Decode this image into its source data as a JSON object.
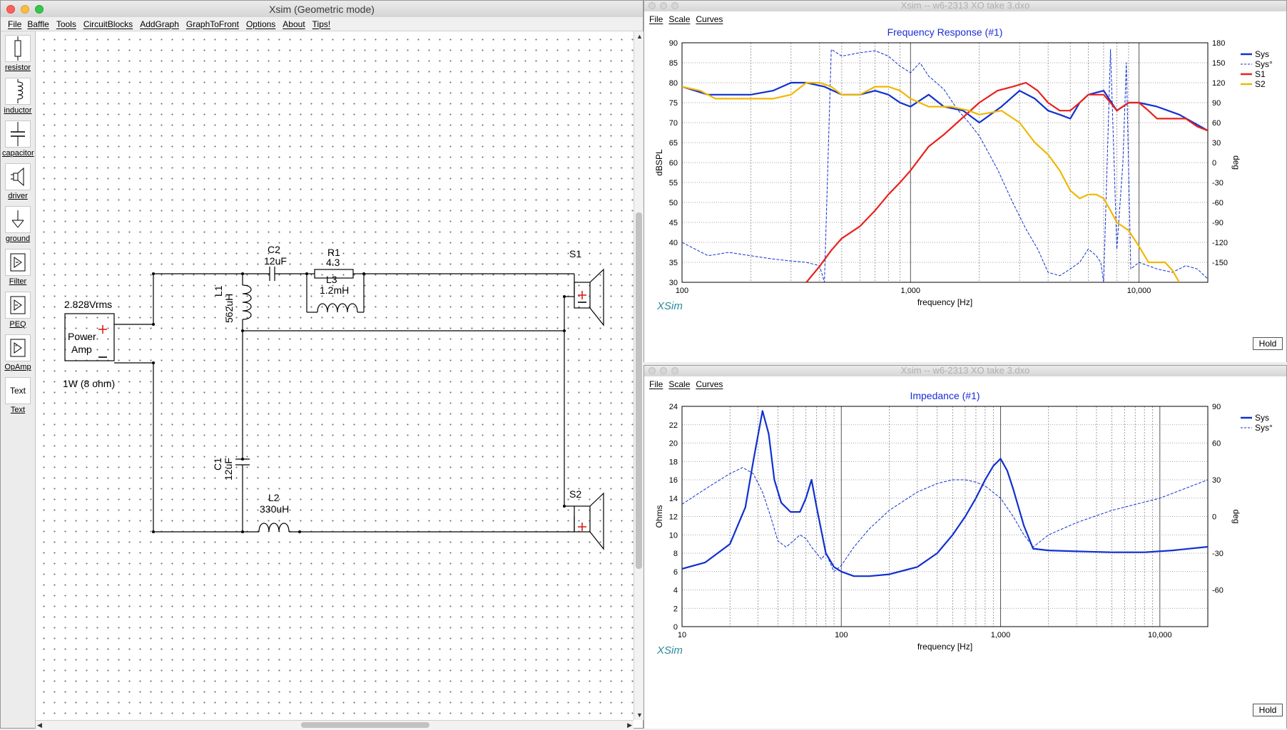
{
  "main_window": {
    "title": "Xsim (Geometric mode)",
    "menu": [
      "File",
      "Baffle",
      "Tools",
      "CircuitBlocks",
      "AddGraph",
      "GraphToFront",
      "Options",
      "About",
      "Tips!"
    ],
    "palette": [
      {
        "label": "resistor",
        "icon": "resistor-icon"
      },
      {
        "label": "inductor",
        "icon": "inductor-icon"
      },
      {
        "label": "capacitor",
        "icon": "capacitor-icon"
      },
      {
        "label": "driver",
        "icon": "speaker-driver-icon"
      },
      {
        "label": "ground",
        "icon": "ground-icon"
      },
      {
        "label": "Filter",
        "icon": "filter-icon"
      },
      {
        "label": "PEQ",
        "icon": "peq-icon"
      },
      {
        "label": "OpAmp",
        "icon": "opamp-icon"
      },
      {
        "label": "Text",
        "icon": "text-icon",
        "icon_text": "Text"
      }
    ]
  },
  "circuit": {
    "amp": {
      "voltage": "2.828Vrms",
      "line1": "Power",
      "line2": "Amp",
      "plus": "+",
      "minus": "−",
      "load": "1W (8 ohm)"
    },
    "c2": {
      "name": "C2",
      "value": "12uF"
    },
    "r1": {
      "name": "R1",
      "value": "4.3"
    },
    "l3": {
      "name": "L3",
      "value": "1.2mH"
    },
    "l1": {
      "name": "L1",
      "value": "562uH"
    },
    "c1": {
      "name": "C1",
      "value": "12uF"
    },
    "l2": {
      "name": "L2",
      "value": "330uH"
    },
    "s1": {
      "name": "S1"
    },
    "s2": {
      "name": "S2"
    }
  },
  "graph_fr": {
    "window_title": "Xsim -- w6-2313 XO take 3.dxo",
    "menu": [
      "File",
      "Scale",
      "Curves"
    ],
    "title": "Frequency Response (#1)",
    "ylabel": "dBSPL",
    "y2label": "deg",
    "xlabel": "frequency [Hz]",
    "yticks": [
      "90",
      "85",
      "80",
      "75",
      "70",
      "65",
      "60",
      "55",
      "50",
      "45",
      "40",
      "35",
      "30"
    ],
    "y2ticks": [
      "180",
      "150",
      "120",
      "90",
      "60",
      "30",
      "0",
      "-30",
      "-60",
      "-90",
      "-120",
      "-150"
    ],
    "xticks": [
      "100",
      "1,000",
      "10,000"
    ],
    "legend": [
      {
        "name": "Sys",
        "color": "#1030d0",
        "dash": false
      },
      {
        "name": "Sys°",
        "color": "#1030d0",
        "dash": true
      },
      {
        "name": "S1",
        "color": "#e8221c",
        "dash": false
      },
      {
        "name": "S2",
        "color": "#f0b800",
        "dash": false
      }
    ],
    "brand": "XSim",
    "hold": "Hold"
  },
  "graph_imp": {
    "window_title": "Xsim -- w6-2313 XO take 3.dxo",
    "menu": [
      "File",
      "Scale",
      "Curves"
    ],
    "title": "Impedance (#1)",
    "ylabel": "Ohms",
    "y2label": "deg",
    "xlabel": "frequency [Hz]",
    "yticks": [
      "24",
      "22",
      "20",
      "18",
      "16",
      "14",
      "12",
      "10",
      "8",
      "6",
      "4",
      "2",
      "0"
    ],
    "y2ticks": [
      "90",
      "60",
      "30",
      "0",
      "-30",
      "-60"
    ],
    "xticks": [
      "10",
      "100",
      "1,000",
      "10,000"
    ],
    "legend": [
      {
        "name": "Sys",
        "color": "#1030d0",
        "dash": false
      },
      {
        "name": "Sys°",
        "color": "#1030d0",
        "dash": true
      }
    ],
    "brand": "XSim",
    "hold": "Hold"
  },
  "chart_data": [
    {
      "type": "line",
      "title": "Frequency Response (#1)",
      "xlabel": "frequency [Hz]",
      "ylabel": "dBSPL",
      "y2label": "deg",
      "xscale": "log",
      "xlim": [
        100,
        20000
      ],
      "ylim": [
        30,
        90
      ],
      "y2lim": [
        -180,
        180
      ],
      "grid": true,
      "legend_position": "right",
      "series": [
        {
          "name": "Sys",
          "axis": "y",
          "x": [
            100,
            130,
            160,
            200,
            250,
            300,
            350,
            420,
            500,
            600,
            700,
            800,
            900,
            1000,
            1200,
            1400,
            1700,
            2000,
            2500,
            3000,
            3500,
            4000,
            4500,
            5000,
            5500,
            6000,
            7000,
            8000,
            9000,
            10000,
            12000,
            15000,
            20000
          ],
          "y": [
            79,
            77,
            77,
            77,
            78,
            80,
            80,
            79,
            77,
            77,
            78,
            77,
            75,
            74,
            77,
            74,
            73,
            70,
            74,
            78,
            76,
            73,
            72,
            71,
            75,
            77,
            78,
            73,
            75,
            75,
            74,
            72,
            68
          ]
        },
        {
          "name": "Sys°",
          "axis": "y2",
          "x": [
            100,
            130,
            160,
            200,
            250,
            300,
            350,
            400,
            420,
            450,
            500,
            600,
            700,
            800,
            900,
            1000,
            1100,
            1200,
            1400,
            1600,
            1800,
            2000,
            2400,
            2800,
            3200,
            3600,
            4000,
            4500,
            5000,
            5500,
            6000,
            6500,
            6800,
            7000,
            7500,
            8000,
            8500,
            8800,
            9200,
            10000,
            12000,
            14000,
            16000,
            18000,
            20000
          ],
          "y": [
            -120,
            -140,
            -135,
            -140,
            -145,
            -148,
            -150,
            -155,
            -180,
            170,
            160,
            165,
            168,
            160,
            145,
            135,
            150,
            130,
            110,
            80,
            60,
            40,
            -10,
            -60,
            -100,
            -130,
            -165,
            -170,
            -160,
            -150,
            -130,
            -140,
            -150,
            -180,
            170,
            -130,
            0,
            150,
            -160,
            -150,
            -160,
            -165,
            -155,
            -160,
            -175
          ]
        },
        {
          "name": "S1",
          "axis": "y",
          "x": [
            350,
            400,
            450,
            500,
            600,
            700,
            800,
            900,
            1000,
            1200,
            1400,
            1600,
            2000,
            2400,
            2800,
            3200,
            3600,
            4000,
            4500,
            5000,
            5500,
            6000,
            6500,
            7000,
            7500,
            8000,
            9000,
            10000,
            11000,
            12000,
            14000,
            16000,
            18000,
            20000
          ],
          "y": [
            30,
            34,
            38,
            41,
            44,
            48,
            52,
            55,
            58,
            64,
            67,
            70,
            75,
            78,
            79,
            80,
            78,
            75,
            73,
            73,
            75,
            77,
            77,
            77,
            75,
            73,
            75,
            75,
            73,
            71,
            71,
            71,
            69,
            68
          ]
        },
        {
          "name": "S2",
          "axis": "y",
          "x": [
            100,
            120,
            140,
            160,
            200,
            250,
            300,
            350,
            400,
            450,
            500,
            600,
            700,
            800,
            900,
            1000,
            1200,
            1500,
            1800,
            2000,
            2500,
            3000,
            3500,
            4000,
            4500,
            5000,
            5500,
            6000,
            6500,
            7000,
            7500,
            8000,
            9000,
            10000,
            11000,
            12000,
            13000,
            14000,
            15000
          ],
          "y": [
            79,
            78,
            76,
            76,
            76,
            76,
            77,
            80,
            80,
            79,
            77,
            77,
            79,
            79,
            78,
            76,
            74,
            74,
            73,
            72,
            73,
            70,
            65,
            62,
            58,
            53,
            51,
            52,
            52,
            51,
            48,
            45,
            43,
            39,
            35,
            35,
            35,
            33,
            30
          ]
        }
      ]
    },
    {
      "type": "line",
      "title": "Impedance (#1)",
      "xlabel": "frequency [Hz]",
      "ylabel": "Ohms",
      "y2label": "deg",
      "xscale": "log",
      "xlim": [
        10,
        20000
      ],
      "ylim": [
        0,
        24
      ],
      "y2lim": [
        -90,
        90
      ],
      "grid": true,
      "legend_position": "right",
      "series": [
        {
          "name": "Sys",
          "axis": "y",
          "x": [
            10,
            14,
            20,
            25,
            28,
            32,
            35,
            38,
            42,
            48,
            55,
            60,
            65,
            70,
            80,
            90,
            100,
            120,
            150,
            200,
            300,
            400,
            500,
            600,
            700,
            800,
            900,
            1000,
            1100,
            1200,
            1400,
            1600,
            2000,
            3000,
            5000,
            8000,
            12000,
            20000
          ],
          "y": [
            6.3,
            7,
            9,
            13,
            18,
            23.5,
            21,
            16,
            13.5,
            12.5,
            12.5,
            14,
            16,
            13,
            8,
            6.5,
            6,
            5.5,
            5.5,
            5.7,
            6.5,
            8,
            10,
            12,
            14,
            16,
            17.5,
            18.3,
            17,
            15,
            11,
            8.5,
            8.3,
            8.2,
            8.1,
            8.1,
            8.3,
            8.7
          ]
        },
        {
          "name": "Sys°",
          "axis": "y2",
          "x": [
            10,
            15,
            20,
            24,
            28,
            32,
            36,
            40,
            45,
            50,
            55,
            60,
            65,
            70,
            75,
            80,
            90,
            100,
            120,
            150,
            200,
            300,
            400,
            500,
            600,
            700,
            800,
            1000,
            1200,
            1400,
            1600,
            2000,
            3000,
            5000,
            10000,
            20000
          ],
          "y": [
            10,
            25,
            35,
            40,
            35,
            20,
            0,
            -20,
            -25,
            -20,
            -15,
            -18,
            -25,
            -30,
            -35,
            -30,
            -45,
            -40,
            -25,
            -10,
            5,
            20,
            27,
            30,
            30,
            28,
            25,
            15,
            0,
            -15,
            -25,
            -15,
            -5,
            5,
            15,
            30
          ]
        }
      ]
    }
  ]
}
